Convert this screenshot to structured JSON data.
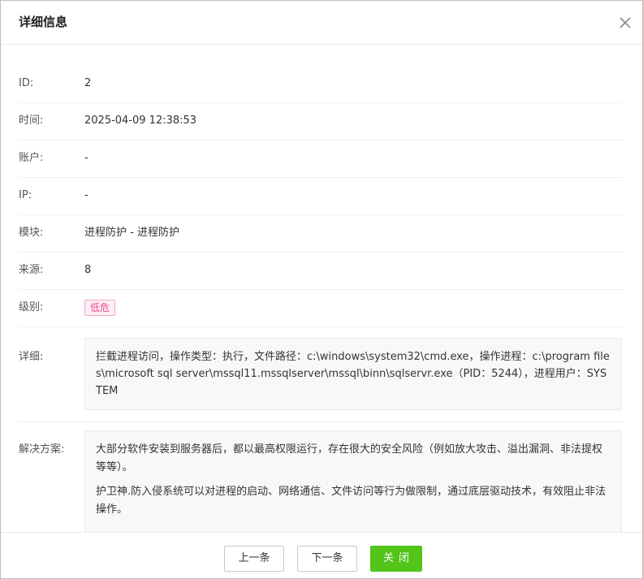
{
  "dialog": {
    "title": "详细信息"
  },
  "fields": {
    "id": {
      "label": "ID:",
      "value": "2"
    },
    "time": {
      "label": "时间:",
      "value": "2025-04-09 12:38:53"
    },
    "account": {
      "label": "账户:",
      "value": "-"
    },
    "ip": {
      "label": "IP:",
      "value": "-"
    },
    "module": {
      "label": "模块:",
      "value": "进程防护 - 进程防护"
    },
    "source": {
      "label": "来源:",
      "value": "8"
    },
    "level": {
      "label": "级别:",
      "value": "低危",
      "badge_color": "#e8488b"
    },
    "detail": {
      "label": "详细:",
      "value": "拦截进程访问，操作类型：执行，文件路径：c:\\windows\\system32\\cmd.exe，操作进程：c:\\program files\\microsoft sql server\\mssql11.mssqlserver\\mssql\\binn\\sqlservr.exe（PID：5244），进程用户：SYSTEM"
    },
    "solution": {
      "label": "解决方案:",
      "paragraphs": [
        "大部分软件安装到服务器后，都以最高权限运行，存在很大的安全风险（例如放大攻击、溢出漏洞、非法提权等等）。",
        "护卫神.防入侵系统可以对进程的启动、网络通信、文件访问等行为做限制，通过底层驱动技术，有效阻止非法操作。"
      ]
    }
  },
  "footer": {
    "prev_label": "上一条",
    "next_label": "下一条",
    "close_label": "关闭"
  },
  "colors": {
    "primary": "#52c41a",
    "badge_low": "#e8488b"
  },
  "icons": {
    "close": "close-icon"
  }
}
